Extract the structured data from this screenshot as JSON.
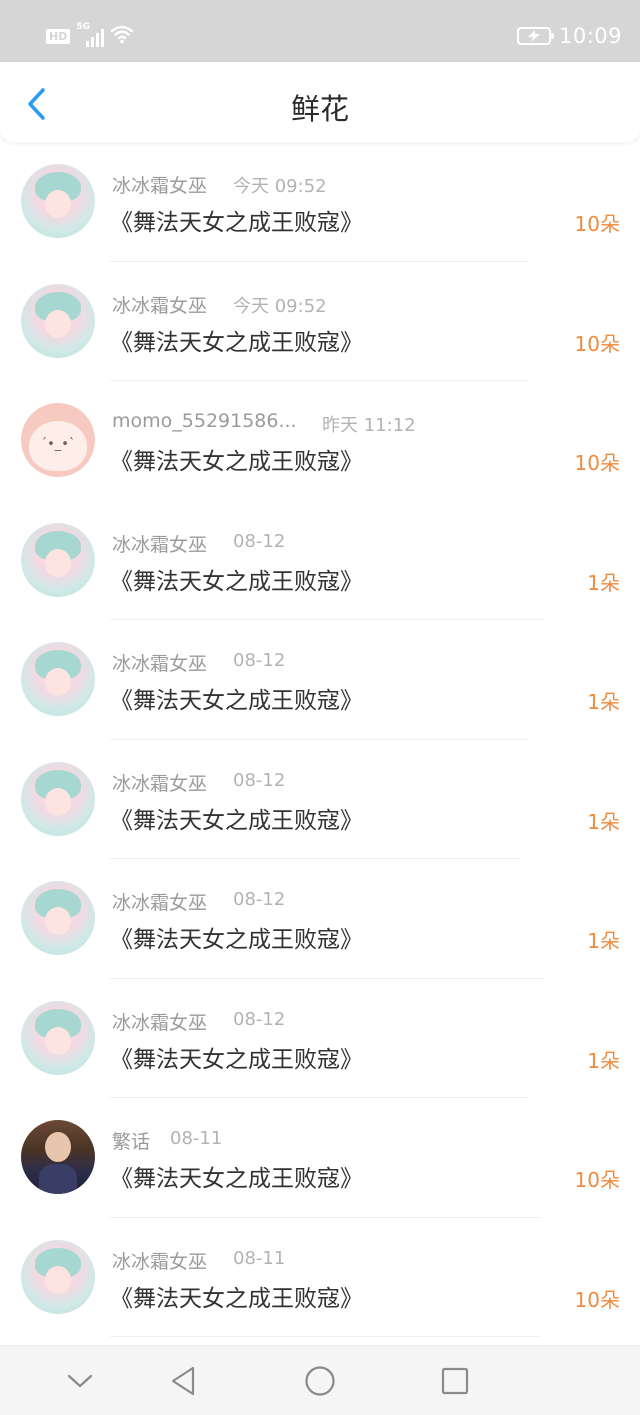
{
  "status": {
    "hd": "HD",
    "network": "5G",
    "time": "10:09"
  },
  "nav": {
    "title": "鲜花",
    "back_icon": "chevron-left-icon",
    "accent": "#2a9bf0"
  },
  "items": [
    {
      "name": "冰冰霜女巫",
      "time": "今天 09:52",
      "book": "《舞法天女之成王败寇》",
      "count": "10朵",
      "avatar": "ice"
    },
    {
      "name": "冰冰霜女巫",
      "time": "今天 09:52",
      "book": "《舞法天女之成王败寇》",
      "count": "10朵",
      "avatar": "ice"
    },
    {
      "name": "momo_55291586...",
      "time": "昨天 11:12",
      "book": "《舞法天女之成王败寇》",
      "count": "10朵",
      "avatar": "momo"
    },
    {
      "name": "冰冰霜女巫",
      "time": "08-12",
      "book": "《舞法天女之成王败寇》",
      "count": "1朵",
      "avatar": "ice"
    },
    {
      "name": "冰冰霜女巫",
      "time": "08-12",
      "book": "《舞法天女之成王败寇》",
      "count": "1朵",
      "avatar": "ice"
    },
    {
      "name": "冰冰霜女巫",
      "time": "08-12",
      "book": "《舞法天女之成王败寇》",
      "count": "1朵",
      "avatar": "ice"
    },
    {
      "name": "冰冰霜女巫",
      "time": "08-12",
      "book": "《舞法天女之成王败寇》",
      "count": "1朵",
      "avatar": "ice"
    },
    {
      "name": "冰冰霜女巫",
      "time": "08-12",
      "book": "《舞法天女之成王败寇》",
      "count": "1朵",
      "avatar": "ice"
    },
    {
      "name": "繁话",
      "time": "08-11",
      "book": "《舞法天女之成王败寇》",
      "count": "10朵",
      "avatar": "person"
    },
    {
      "name": "冰冰霜女巫",
      "time": "08-11",
      "book": "《舞法天女之成王败寇》",
      "count": "10朵",
      "avatar": "ice"
    }
  ],
  "system_nav": {
    "icons": [
      "chevron-down-icon",
      "back-triangle-icon",
      "home-circle-icon",
      "recents-square-icon"
    ]
  },
  "colors": {
    "count": "#f08a3c",
    "status_bar": "#d6d6d6"
  }
}
